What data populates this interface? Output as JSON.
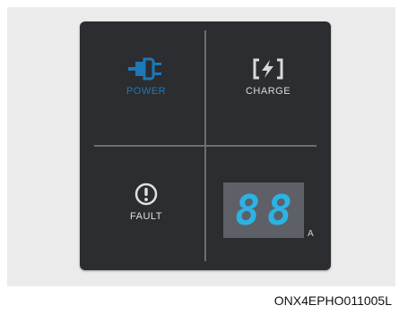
{
  "panel": {
    "power": {
      "label": "POWER",
      "icon": "plug-icon",
      "color": "#1e78b4"
    },
    "charge": {
      "label": "CHARGE",
      "icon": "lightning-bolt-icon",
      "color": "#d9d9d9"
    },
    "fault": {
      "label": "FAULT",
      "icon": "exclamation-circle-icon",
      "color": "#e0e0e0"
    },
    "display": {
      "digit1": "8",
      "digit2": "8",
      "unit": "A",
      "color": "#2bb3e6"
    }
  },
  "image_code": "ONX4EPHO011005L"
}
